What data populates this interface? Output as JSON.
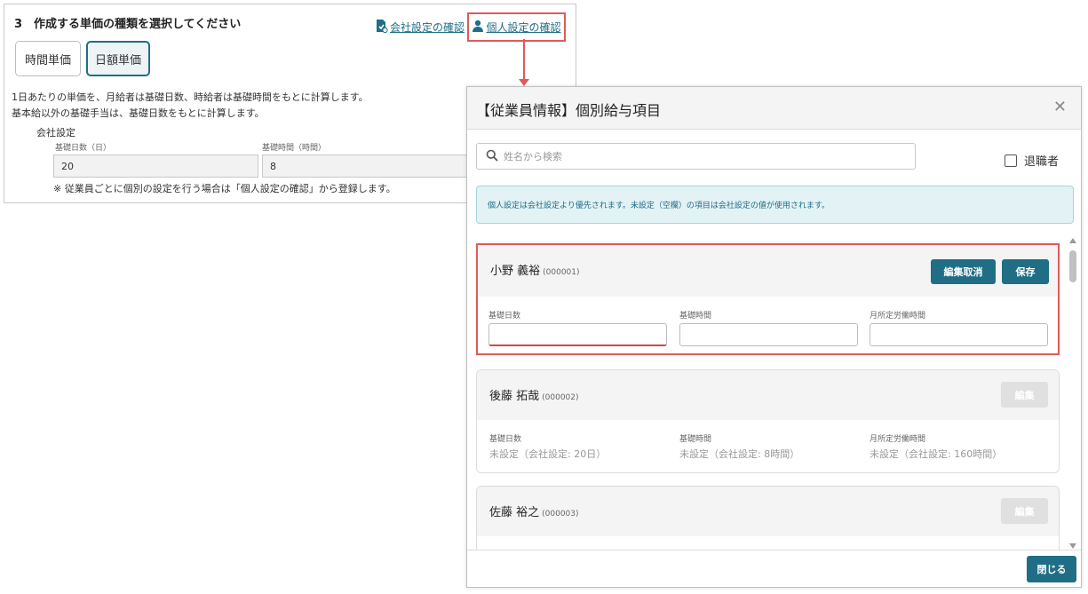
{
  "settings": {
    "section_title": "3　作成する単価の種類を選択してください",
    "link_company": "会社設定の確認",
    "link_personal": "個人設定の確認",
    "unit_options": [
      {
        "label": "時間単価",
        "selected": false
      },
      {
        "label": "日額単価",
        "selected": true
      }
    ],
    "description_line1": "1日あたりの単価を、月給者は基礎日数、時給者は基礎時間をもとに計算します。",
    "description_line2": "基本給以外の基礎手当は、基礎日数をもとに計算します。",
    "company_setting_label": "会社設定",
    "base_days_label": "基礎日数（日）",
    "base_days_value": "20",
    "base_hours_label": "基礎時間（時間）",
    "base_hours_value": "8",
    "note": "※ 従業員ごとに個別の設定を行う場合は「個人設定の確認」から登録します。"
  },
  "modal": {
    "title": "【従業員情報】個別給与項目",
    "search_placeholder": "姓名から検索",
    "retired_label": "退職者",
    "retired_checked": false,
    "info_message": "個人設定は会社設定より優先されます。未設定（空欄）の項目は会社設定の値が使用されます。",
    "field_labels": {
      "base_days": "基礎日数",
      "base_hours": "基礎時間",
      "monthly_hours": "月所定労働時間"
    },
    "employees": [
      {
        "name": "小野 義裕",
        "code": "(000001)",
        "editing": true,
        "cancel_label": "編集取消",
        "save_label": "保存",
        "base_days": "",
        "base_hours": "",
        "monthly_hours": ""
      },
      {
        "name": "後藤 拓哉",
        "code": "(000002)",
        "editing": false,
        "edit_label": "編集",
        "base_days": "未設定（会社設定: 20日）",
        "base_hours": "未設定（会社設定: 8時間）",
        "monthly_hours": "未設定（会社設定: 160時間）"
      },
      {
        "name": "佐藤 裕之",
        "code": "(000003)",
        "editing": false,
        "edit_label": "編集"
      }
    ],
    "close_label": "閉じる"
  },
  "colors": {
    "accent": "#1f6e86",
    "highlight": "#e05a5a",
    "info_bg": "#e3f2f5"
  }
}
